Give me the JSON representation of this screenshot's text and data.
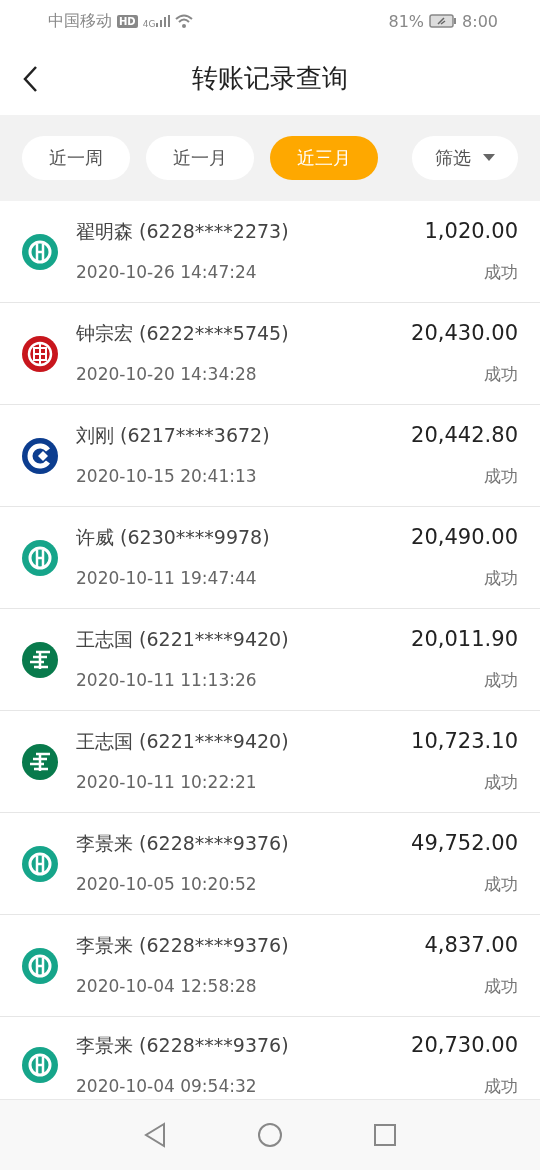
{
  "status_bar": {
    "carrier": "中国移动",
    "hd": "HD",
    "network": "4G",
    "battery": "81%",
    "time": "8:00"
  },
  "header": {
    "title": "转账记录查询"
  },
  "filters": [
    {
      "label": "近一周",
      "selected": false
    },
    {
      "label": "近一月",
      "selected": false
    },
    {
      "label": "近三月",
      "selected": true
    }
  ],
  "filter_button": {
    "label": "筛选"
  },
  "records": [
    {
      "kind": "abc",
      "name": "翟明森 (6228****2273)",
      "time": "2020-10-26 14:47:24",
      "amount": "1,020.00",
      "status": "成功"
    },
    {
      "kind": "icbc",
      "name": "钟宗宏 (6222****5745)",
      "time": "2020-10-20 14:34:28",
      "amount": "20,430.00",
      "status": "成功"
    },
    {
      "kind": "ccb",
      "name": "刘刚 (6217****3672)",
      "time": "2020-10-15 20:41:13",
      "amount": "20,442.80",
      "status": "成功"
    },
    {
      "kind": "abc",
      "name": "许威 (6230****9978)",
      "time": "2020-10-11 19:47:44",
      "amount": "20,490.00",
      "status": "成功"
    },
    {
      "kind": "post",
      "name": "王志国 (6221****9420)",
      "time": "2020-10-11 11:13:26",
      "amount": "20,011.90",
      "status": "成功"
    },
    {
      "kind": "post",
      "name": "王志国 (6221****9420)",
      "time": "2020-10-11 10:22:21",
      "amount": "10,723.10",
      "status": "成功"
    },
    {
      "kind": "abc",
      "name": "李景来 (6228****9376)",
      "time": "2020-10-05 10:20:52",
      "amount": "49,752.00",
      "status": "成功"
    },
    {
      "kind": "abc",
      "name": "李景来 (6228****9376)",
      "time": "2020-10-04 12:58:28",
      "amount": "4,837.00",
      "status": "成功"
    },
    {
      "kind": "abc",
      "name": "李景来 (6228****9376)",
      "time": "2020-10-04 09:54:32",
      "amount": "20,730.00",
      "status": "成功"
    }
  ]
}
